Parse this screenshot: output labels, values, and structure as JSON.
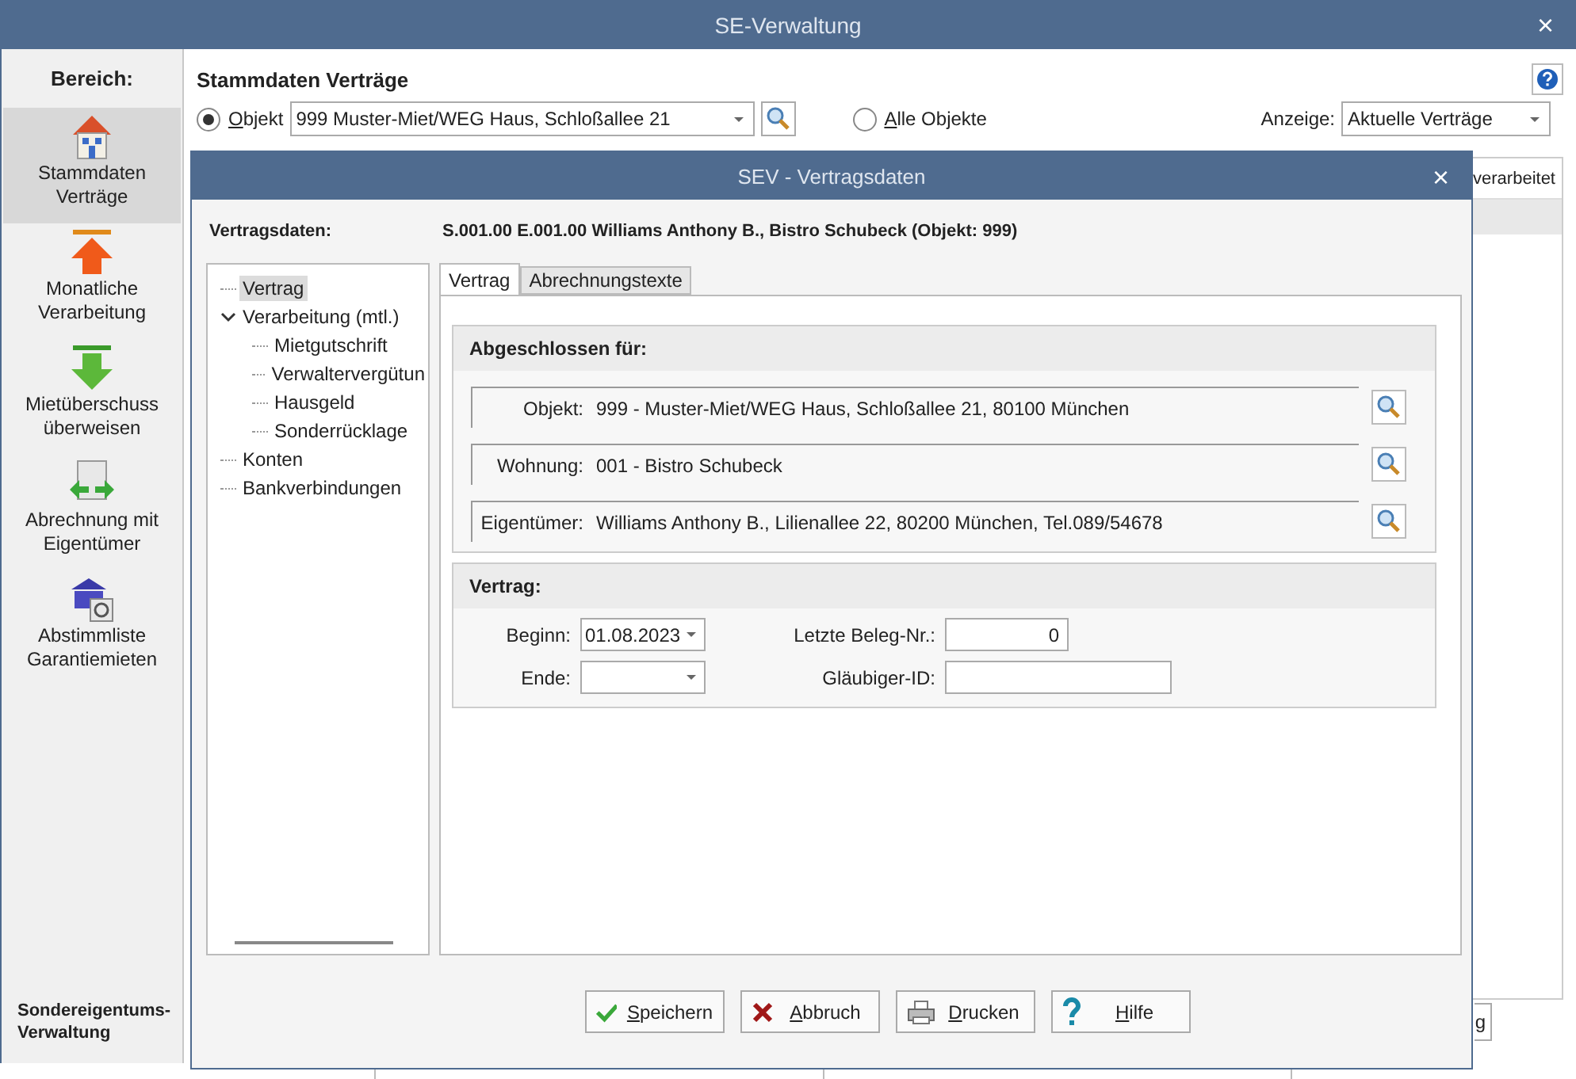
{
  "window": {
    "title": "SE-Verwaltung",
    "close": "×"
  },
  "sidebar": {
    "heading": "Bereich:",
    "items": [
      {
        "label": "Stammdaten Verträge",
        "kind": "house",
        "selected": true
      },
      {
        "label": "Monatliche Verarbeitung",
        "kind": "up",
        "selected": false
      },
      {
        "label": "Mietüberschuss überweisen",
        "kind": "down",
        "selected": false
      },
      {
        "label": "Abrechnung mit Eigentümer",
        "kind": "exchange",
        "selected": false
      },
      {
        "label": "Abstimmliste Garantiemieten",
        "kind": "bank",
        "selected": false
      }
    ],
    "footer": "Sondereigentums-Verwaltung"
  },
  "main": {
    "title": "Stammdaten Verträge",
    "radios": [
      {
        "label": "Objekt",
        "selected": true
      },
      {
        "label": "Alle Objekte",
        "selected": false
      }
    ],
    "object_combo": "999 Muster-Miet/WEG Haus, Schloßallee 21",
    "display_label": "Anzeige:",
    "display_combo": "Aktuelle Verträge",
    "table": {
      "column_partial": "verarbeitet"
    },
    "button_partial": "g"
  },
  "dialog": {
    "title": "SEV - Vertragsdaten",
    "close": "×",
    "label": "Vertragsdaten:",
    "record": "S.001.00 E.001.00 Williams Anthony B., Bistro Schubeck (Objekt: 999)",
    "tree": [
      {
        "label": "Vertrag",
        "selected": true
      },
      {
        "label": "Verarbeitung (mtl.)",
        "selected": false,
        "expanded": true,
        "children": [
          {
            "label": "Mietgutschrift",
            "selected": false
          },
          {
            "label": "Verwaltervergütun",
            "selected": false
          },
          {
            "label": "Hausgeld",
            "selected": false
          },
          {
            "label": "Sonderrücklage",
            "selected": false
          }
        ]
      },
      {
        "label": "Konten",
        "selected": false
      },
      {
        "label": "Bankverbindungen",
        "selected": false
      }
    ],
    "tabs": [
      {
        "label": "Vertrag",
        "selected": true
      },
      {
        "label": "Abrechnungstexte",
        "selected": false
      }
    ],
    "assigned": {
      "title": "Abgeschlossen für:",
      "rows": [
        {
          "label": "Objekt:",
          "value": "999 - Muster-Miet/WEG Haus, Schloßallee 21, 80100 München"
        },
        {
          "label": "Wohnung:",
          "value": "001 - Bistro Schubeck"
        },
        {
          "label": "Eigentümer:",
          "value": "Williams Anthony B., Lilienallee 22, 80200 München, Tel.089/54678"
        }
      ]
    },
    "contract": {
      "title": "Vertrag:",
      "fields": [
        {
          "kind": "date",
          "label": "Beginn:",
          "value": "01.08.2023"
        },
        {
          "kind": "number",
          "label": "Letzte Beleg-Nr.:",
          "value": "0"
        },
        {
          "kind": "date",
          "label": "Ende:"
        },
        {
          "kind": "text",
          "label": "Gläubiger-ID:"
        }
      ]
    },
    "buttons": [
      {
        "label": "Speichern",
        "kind": "save"
      },
      {
        "label": "Abbruch",
        "kind": "cancel"
      },
      {
        "label": "Drucken",
        "kind": "print"
      },
      {
        "label": "Hilfe",
        "kind": "help"
      }
    ]
  }
}
